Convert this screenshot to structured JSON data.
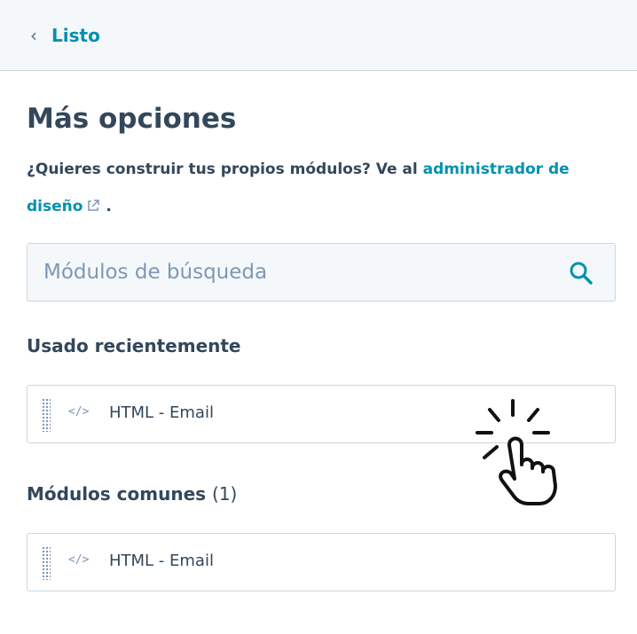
{
  "header": {
    "back_label": "Listo"
  },
  "panel": {
    "title": "Más opciones",
    "intro_text": "¿Quieres construir tus propios módulos? Ve al ",
    "intro_link": "administrador de diseño",
    "intro_end": " ."
  },
  "search": {
    "placeholder": "Módulos de búsqueda",
    "value": ""
  },
  "recent": {
    "heading": "Usado recientemente",
    "items": [
      {
        "label": "HTML - Email",
        "icon": "code-icon"
      }
    ]
  },
  "common": {
    "heading": "Módulos comunes",
    "count": "(1)",
    "items": [
      {
        "label": "HTML - Email",
        "icon": "code-icon"
      }
    ]
  },
  "colors": {
    "text": "#33475b",
    "link": "#0091ae",
    "border": "#cbd6e2",
    "header_bg": "#f5f8fa"
  },
  "icons": {
    "cursor": "pointer-hand-click-icon",
    "external": "external-link-icon",
    "search": "search-icon"
  }
}
